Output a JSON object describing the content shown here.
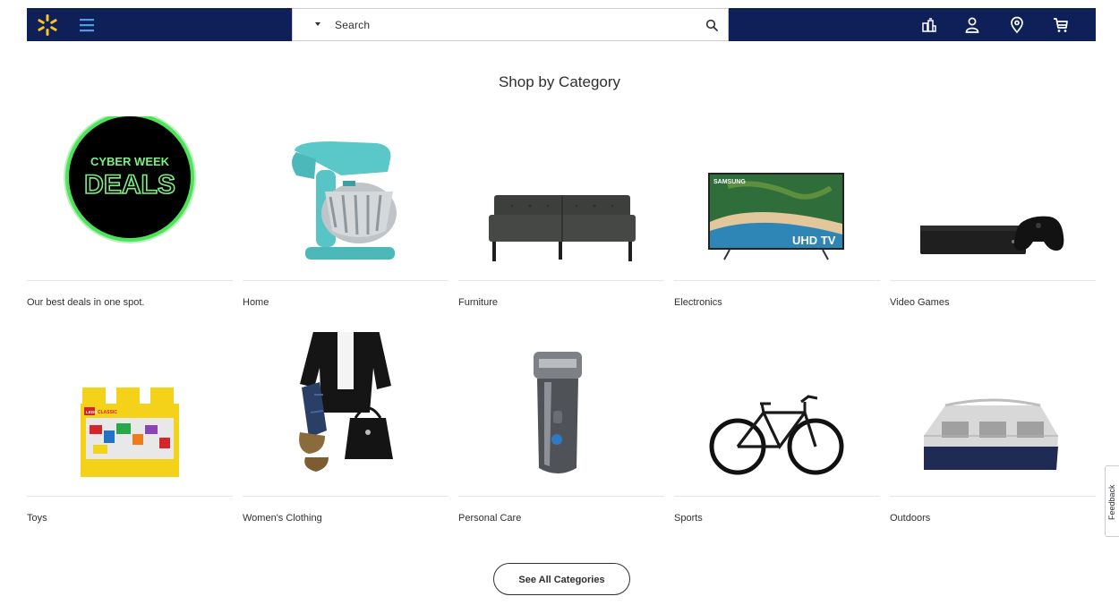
{
  "header": {
    "search_placeholder": "Search",
    "brand_color": "#0e2057",
    "spark_color": "#ffc220",
    "icons": [
      "walmart-spark-icon",
      "menu-icon",
      "chevron-down-icon",
      "search-icon",
      "reorder-icon",
      "account-icon",
      "location-icon",
      "cart-icon"
    ]
  },
  "page": {
    "title": "Shop by Category"
  },
  "categories": [
    {
      "label": "Our best deals in one spot.",
      "badge_line1": "CYBER WEEK",
      "badge_line2": "DEALS"
    },
    {
      "label": "Home"
    },
    {
      "label": "Furniture"
    },
    {
      "label": "Electronics",
      "tv_brand": "SAMSUNG",
      "tv_badge": "UHD TV"
    },
    {
      "label": "Video Games"
    },
    {
      "label": "Toys",
      "toy_brand": "LEGO",
      "toy_line": "CLASSIC"
    },
    {
      "label": "Women's Clothing"
    },
    {
      "label": "Personal Care"
    },
    {
      "label": "Sports"
    },
    {
      "label": "Outdoors"
    }
  ],
  "see_all_label": "See All Categories",
  "feedback_label": "Feedback"
}
